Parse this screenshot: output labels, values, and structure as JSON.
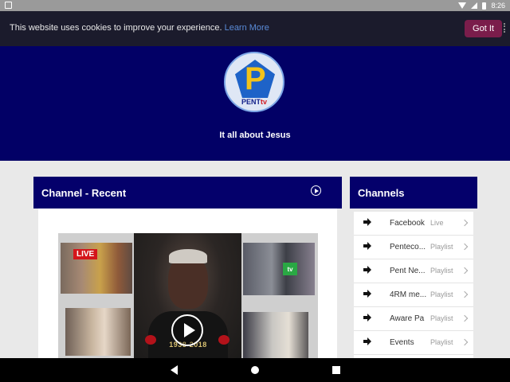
{
  "status_bar": {
    "time": "8:26"
  },
  "cookie_banner": {
    "message": "This website uses cookies to improve your experience.",
    "learn_more": "Learn More",
    "accept": "Got It"
  },
  "header": {
    "logo_brand": "PENT",
    "logo_brand_suffix": "tv",
    "logo_letter": "P",
    "tagline": "It all about Jesus"
  },
  "recent": {
    "title": "Channel - Recent",
    "live_badge": "LIVE",
    "years": "1938-2018",
    "overlay_badge": "tv"
  },
  "channels": {
    "title": "Channels",
    "items": [
      {
        "name": "Facebook",
        "type": "Live"
      },
      {
        "name": "Penteco...",
        "type": "Playlist"
      },
      {
        "name": "Pent Ne...",
        "type": "Playlist"
      },
      {
        "name": "4RM me...",
        "type": "Playlist"
      },
      {
        "name": "Aware Pa",
        "type": "Playlist"
      },
      {
        "name": "Events",
        "type": "Playlist"
      }
    ]
  },
  "colors": {
    "header_bg": "#020066",
    "card_head_bg": "#04006b",
    "cookie_bg": "#1b1b2c",
    "accept_bg": "#7a1d4b",
    "link": "#5a8bd8"
  }
}
